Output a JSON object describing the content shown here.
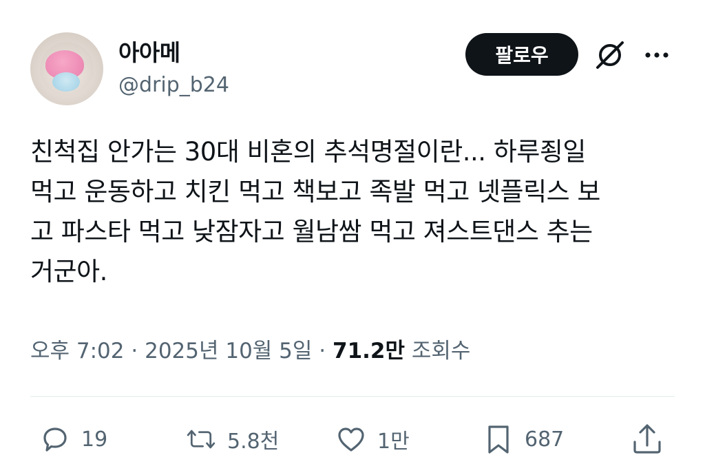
{
  "user": {
    "display_name": "아아메",
    "handle": "@drip_b24"
  },
  "header": {
    "follow_label": "팔로우"
  },
  "tweet": {
    "lines": [
      "친척집 안가는 30대 비혼의 추석명절이란... 하루죙일",
      "먹고 운동하고 치킨 먹고 책보고 족발 먹고 넷플릭스 보",
      "고 파스타 먹고 낮잠자고 월남쌈 먹고 져스트댄스 추는",
      "거군아."
    ]
  },
  "meta": {
    "time": "오후 7:02",
    "date": "2025년 10월 5일",
    "separator": "·",
    "views_count": "71.2만",
    "views_label": "조회수"
  },
  "actions": {
    "replies": "19",
    "reposts": "5.8천",
    "likes": "1만",
    "bookmarks": "687"
  },
  "icons": {
    "grok": "grok-icon",
    "more": "more-icon",
    "reply": "reply-icon",
    "repost": "repost-icon",
    "like": "heart-icon",
    "bookmark": "bookmark-icon",
    "share": "share-icon"
  },
  "colors": {
    "text": "#0f1419",
    "secondary": "#536471",
    "button_bg": "#0f1419",
    "divider": "#eff3f4"
  }
}
